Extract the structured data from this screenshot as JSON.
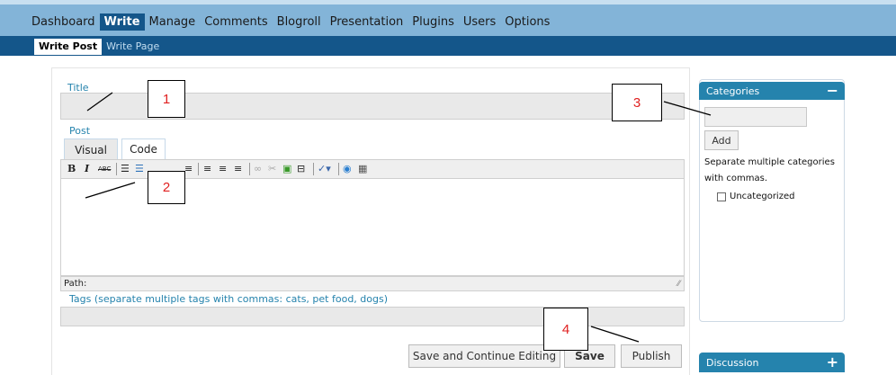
{
  "topnav": {
    "items": [
      {
        "label": "Dashboard",
        "active": false
      },
      {
        "label": "Write",
        "active": true
      },
      {
        "label": "Manage",
        "active": false
      },
      {
        "label": "Comments",
        "active": false
      },
      {
        "label": "Blogroll",
        "active": false
      },
      {
        "label": "Presentation",
        "active": false
      },
      {
        "label": "Plugins",
        "active": false
      },
      {
        "label": "Users",
        "active": false
      },
      {
        "label": "Options",
        "active": false
      }
    ]
  },
  "subnav": {
    "items": [
      {
        "label": "Write Post",
        "active": true
      },
      {
        "label": "Write Page",
        "active": false
      }
    ]
  },
  "form": {
    "title_label": "Title",
    "title_value": "",
    "post_label": "Post",
    "tabs": [
      {
        "label": "Visual",
        "active": true
      },
      {
        "label": "Code",
        "active": false
      }
    ],
    "toolbar_icons": [
      "bold-icon",
      "italic-icon",
      "strikethrough-icon",
      "bullet-list-icon",
      "numbered-list-icon",
      "blockquote-icon",
      "align-left-icon",
      "align-center-icon",
      "align-right-icon",
      "link-icon",
      "unlink-icon",
      "image-icon",
      "more-break-icon",
      "spellcheck-icon",
      "help-icon",
      "toolbar-toggle-icon"
    ],
    "toolbar_bold": "B",
    "toolbar_italic": "I",
    "toolbar_strike": "ABC",
    "path_label": "Path:",
    "tags_label": "Tags (separate multiple tags with commas: cats, pet food, dogs)",
    "tags_value": ""
  },
  "actions": {
    "save_continue_label": "Save and Continue Editing",
    "save_label": "Save",
    "publish_label": "Publish"
  },
  "sidebar": {
    "categories": {
      "title": "Categories",
      "toggle": "−",
      "add_label": "Add",
      "hint": "Separate multiple categories with commas.",
      "items": [
        {
          "label": "Uncategorized",
          "checked": false
        }
      ]
    },
    "discussion": {
      "title": "Discussion",
      "toggle": "+"
    }
  },
  "annotations": [
    "1",
    "2",
    "3",
    "4"
  ],
  "colors": {
    "topnav_bg": "#83b4d8",
    "subnav_bg": "#14568a",
    "accent": "#2583ad",
    "annotation_text": "#e02020"
  }
}
